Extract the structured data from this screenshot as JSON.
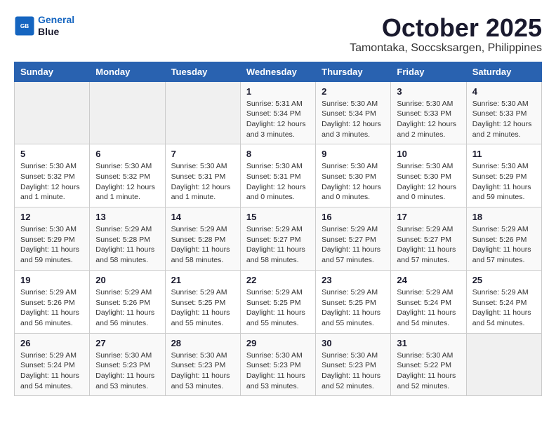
{
  "header": {
    "logo_line1": "General",
    "logo_line2": "Blue",
    "month": "October 2025",
    "location": "Tamontaka, Soccsksargen, Philippines"
  },
  "weekdays": [
    "Sunday",
    "Monday",
    "Tuesday",
    "Wednesday",
    "Thursday",
    "Friday",
    "Saturday"
  ],
  "weeks": [
    [
      {
        "day": "",
        "info": ""
      },
      {
        "day": "",
        "info": ""
      },
      {
        "day": "",
        "info": ""
      },
      {
        "day": "1",
        "info": "Sunrise: 5:31 AM\nSunset: 5:34 PM\nDaylight: 12 hours\nand 3 minutes."
      },
      {
        "day": "2",
        "info": "Sunrise: 5:30 AM\nSunset: 5:34 PM\nDaylight: 12 hours\nand 3 minutes."
      },
      {
        "day": "3",
        "info": "Sunrise: 5:30 AM\nSunset: 5:33 PM\nDaylight: 12 hours\nand 2 minutes."
      },
      {
        "day": "4",
        "info": "Sunrise: 5:30 AM\nSunset: 5:33 PM\nDaylight: 12 hours\nand 2 minutes."
      }
    ],
    [
      {
        "day": "5",
        "info": "Sunrise: 5:30 AM\nSunset: 5:32 PM\nDaylight: 12 hours\nand 1 minute."
      },
      {
        "day": "6",
        "info": "Sunrise: 5:30 AM\nSunset: 5:32 PM\nDaylight: 12 hours\nand 1 minute."
      },
      {
        "day": "7",
        "info": "Sunrise: 5:30 AM\nSunset: 5:31 PM\nDaylight: 12 hours\nand 1 minute."
      },
      {
        "day": "8",
        "info": "Sunrise: 5:30 AM\nSunset: 5:31 PM\nDaylight: 12 hours\nand 0 minutes."
      },
      {
        "day": "9",
        "info": "Sunrise: 5:30 AM\nSunset: 5:30 PM\nDaylight: 12 hours\nand 0 minutes."
      },
      {
        "day": "10",
        "info": "Sunrise: 5:30 AM\nSunset: 5:30 PM\nDaylight: 12 hours\nand 0 minutes."
      },
      {
        "day": "11",
        "info": "Sunrise: 5:30 AM\nSunset: 5:29 PM\nDaylight: 11 hours\nand 59 minutes."
      }
    ],
    [
      {
        "day": "12",
        "info": "Sunrise: 5:30 AM\nSunset: 5:29 PM\nDaylight: 11 hours\nand 59 minutes."
      },
      {
        "day": "13",
        "info": "Sunrise: 5:29 AM\nSunset: 5:28 PM\nDaylight: 11 hours\nand 58 minutes."
      },
      {
        "day": "14",
        "info": "Sunrise: 5:29 AM\nSunset: 5:28 PM\nDaylight: 11 hours\nand 58 minutes."
      },
      {
        "day": "15",
        "info": "Sunrise: 5:29 AM\nSunset: 5:27 PM\nDaylight: 11 hours\nand 58 minutes."
      },
      {
        "day": "16",
        "info": "Sunrise: 5:29 AM\nSunset: 5:27 PM\nDaylight: 11 hours\nand 57 minutes."
      },
      {
        "day": "17",
        "info": "Sunrise: 5:29 AM\nSunset: 5:27 PM\nDaylight: 11 hours\nand 57 minutes."
      },
      {
        "day": "18",
        "info": "Sunrise: 5:29 AM\nSunset: 5:26 PM\nDaylight: 11 hours\nand 57 minutes."
      }
    ],
    [
      {
        "day": "19",
        "info": "Sunrise: 5:29 AM\nSunset: 5:26 PM\nDaylight: 11 hours\nand 56 minutes."
      },
      {
        "day": "20",
        "info": "Sunrise: 5:29 AM\nSunset: 5:26 PM\nDaylight: 11 hours\nand 56 minutes."
      },
      {
        "day": "21",
        "info": "Sunrise: 5:29 AM\nSunset: 5:25 PM\nDaylight: 11 hours\nand 55 minutes."
      },
      {
        "day": "22",
        "info": "Sunrise: 5:29 AM\nSunset: 5:25 PM\nDaylight: 11 hours\nand 55 minutes."
      },
      {
        "day": "23",
        "info": "Sunrise: 5:29 AM\nSunset: 5:25 PM\nDaylight: 11 hours\nand 55 minutes."
      },
      {
        "day": "24",
        "info": "Sunrise: 5:29 AM\nSunset: 5:24 PM\nDaylight: 11 hours\nand 54 minutes."
      },
      {
        "day": "25",
        "info": "Sunrise: 5:29 AM\nSunset: 5:24 PM\nDaylight: 11 hours\nand 54 minutes."
      }
    ],
    [
      {
        "day": "26",
        "info": "Sunrise: 5:29 AM\nSunset: 5:24 PM\nDaylight: 11 hours\nand 54 minutes."
      },
      {
        "day": "27",
        "info": "Sunrise: 5:30 AM\nSunset: 5:23 PM\nDaylight: 11 hours\nand 53 minutes."
      },
      {
        "day": "28",
        "info": "Sunrise: 5:30 AM\nSunset: 5:23 PM\nDaylight: 11 hours\nand 53 minutes."
      },
      {
        "day": "29",
        "info": "Sunrise: 5:30 AM\nSunset: 5:23 PM\nDaylight: 11 hours\nand 53 minutes."
      },
      {
        "day": "30",
        "info": "Sunrise: 5:30 AM\nSunset: 5:23 PM\nDaylight: 11 hours\nand 52 minutes."
      },
      {
        "day": "31",
        "info": "Sunrise: 5:30 AM\nSunset: 5:22 PM\nDaylight: 11 hours\nand 52 minutes."
      },
      {
        "day": "",
        "info": ""
      }
    ]
  ]
}
